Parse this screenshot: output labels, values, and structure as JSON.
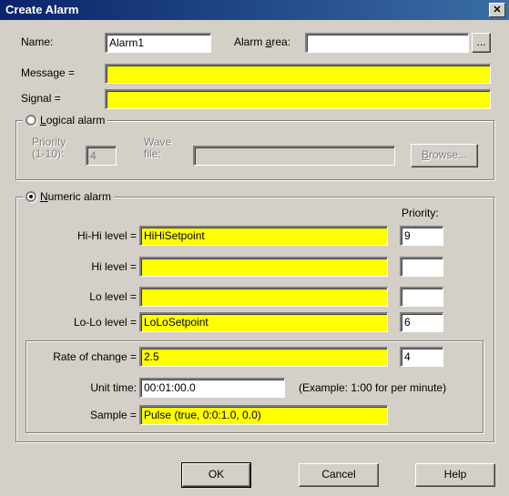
{
  "window": {
    "title": "Create Alarm",
    "close_glyph": "✕"
  },
  "name": {
    "label": "Name:",
    "value": "Alarm1"
  },
  "alarm_area": {
    "label_prefix": "Alarm ",
    "label_accel": "a",
    "label_suffix": "rea:",
    "value": "",
    "browse_label": "..."
  },
  "message": {
    "label": "Message =",
    "value": ""
  },
  "signal": {
    "label": "Signal =",
    "value": ""
  },
  "logical": {
    "radio_accel": "L",
    "radio_rest": "ogical alarm",
    "selected": false,
    "priority_label_1": "Priority",
    "priority_label_2": "(1-10):",
    "priority_value": "4",
    "wave_label_1": "Wave",
    "wave_label_2": "file:",
    "wave_value": "",
    "browse_accel": "B",
    "browse_rest": "rowse..."
  },
  "numeric": {
    "radio_accel": "N",
    "radio_rest": "umeric alarm",
    "selected": true,
    "priority_header": "Priority:",
    "levels": [
      {
        "label": "Hi-Hi level =",
        "value": "HiHiSetpoint",
        "priority": "9"
      },
      {
        "label": "Hi level =",
        "value": "",
        "priority": ""
      },
      {
        "label": "Lo level =",
        "value": "",
        "priority": ""
      },
      {
        "label": "Lo-Lo level =",
        "value": "LoLoSetpoint",
        "priority": "6"
      }
    ],
    "rate": {
      "label": "Rate of change =",
      "value": "2.5",
      "priority": "4",
      "unit_time_label": "Unit time:",
      "unit_time_value": "00:01:00.0",
      "example_text": "(Example: 1:00 for per minute)",
      "sample_label": "Sample =",
      "sample_value": "Pulse (true, 0:0:1.0, 0.0)"
    }
  },
  "buttons": {
    "ok": "OK",
    "cancel": "Cancel",
    "help": "Help"
  },
  "colors": {
    "title_bar": "#0a246a",
    "dialog_bg": "#d4d0c8",
    "required_field": "#ffff00"
  }
}
